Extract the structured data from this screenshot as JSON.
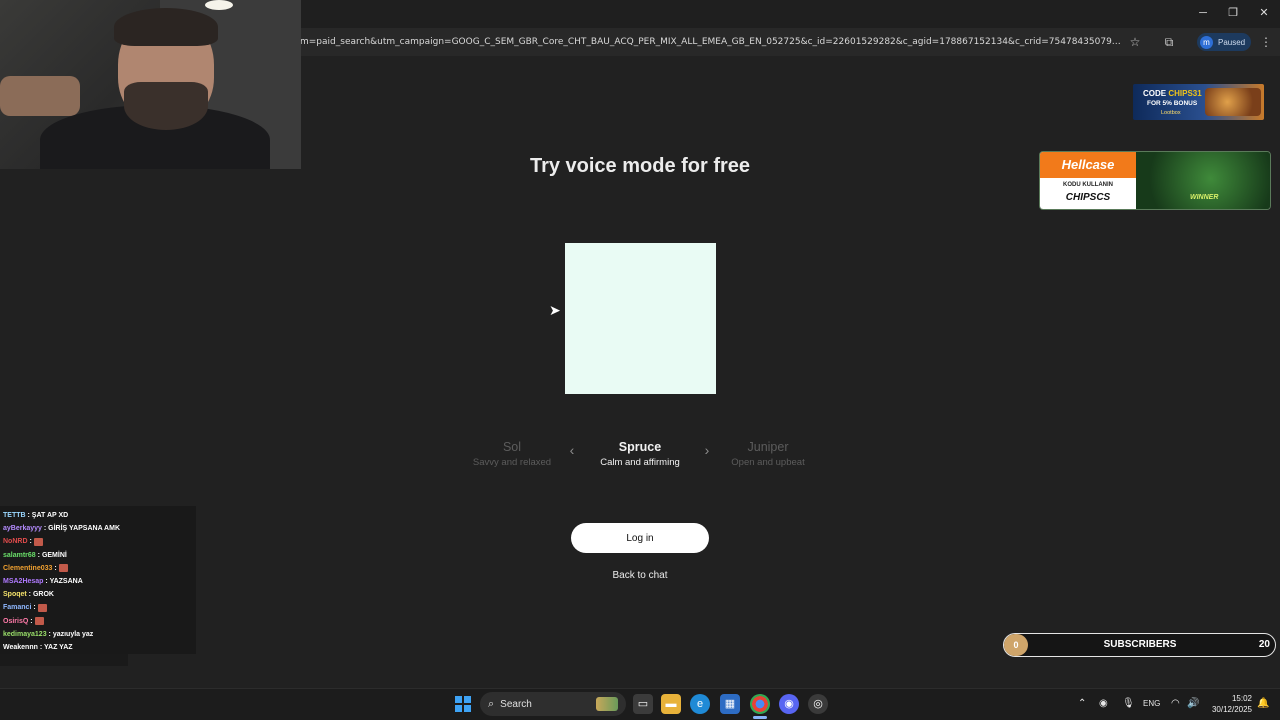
{
  "browser": {
    "url": "m=paid_search&utm_campaign=GOOG_C_SEM_GBR_Core_CHT_BAU_ACQ_PER_MIX_ALL_EMEA_GB_EN_052725&c_id=22601529282&c_agid=178867152134&c_crid=754784350792&c_kwid={keywor...",
    "profile_initial": "m",
    "profile_status": "Paused",
    "icons": [
      "star-icon",
      "extensions-icon",
      "menu-icon",
      "minimize-icon",
      "restore-icon",
      "close-icon"
    ]
  },
  "page": {
    "title": "Try voice mode for free",
    "orb_color": "#e9fbf4",
    "voices": {
      "prev": {
        "name": "Sol",
        "desc": "Savvy and relaxed"
      },
      "current": {
        "name": "Spruce",
        "desc": "Calm and affirming"
      },
      "next": {
        "name": "Juniper",
        "desc": "Open and upbeat"
      }
    },
    "login_label": "Log in",
    "back_label": "Back to chat"
  },
  "overlays": {
    "ad1": {
      "code_prefix": "CODE",
      "code": "CHIPS31",
      "bonus": "FOR 5% BONUS",
      "brand": "Lootbox"
    },
    "ad2": {
      "brand": "Hellcase",
      "line1": "KODU KULLANIN",
      "code": "CHIPSCS",
      "badge": "WINNER"
    },
    "subscribers": {
      "current": "0",
      "label": "SUBSCRIBERS",
      "goal": "20",
      "progress_fraction": 0
    }
  },
  "chat": [
    {
      "user": "TETTB",
      "color": "#9ad7ff",
      "msg": "ŞAT AP XD",
      "emote": false
    },
    {
      "user": "ayBerkayyy",
      "color": "#b48cff",
      "msg": "GİRİŞ YAPSANA AMK",
      "emote": false
    },
    {
      "user": "NoNRD",
      "color": "#e04b4b",
      "msg": "",
      "emote": true
    },
    {
      "user": "salamtr68",
      "color": "#6adf6a",
      "msg": "GEMİNİ",
      "emote": false
    },
    {
      "user": "Clementine033",
      "color": "#f0a030",
      "msg": "",
      "emote": true
    },
    {
      "user": "MSA2Hesap",
      "color": "#b07aff",
      "msg": "YAZSANA",
      "emote": false
    },
    {
      "user": "Spoqet",
      "color": "#f2e06a",
      "msg": "GROK",
      "emote": false
    },
    {
      "user": "Famanci",
      "color": "#8fb8ff",
      "msg": "",
      "emote": true
    },
    {
      "user": "OsirisQ",
      "color": "#ff7aa8",
      "msg": "",
      "emote": true
    },
    {
      "user": "kedimaya123",
      "color": "#9adf6a",
      "msg": "yazıuyla yaz",
      "emote": false
    },
    {
      "user": "Weakennn",
      "color": "#ffffff",
      "msg": "YAZ YAZ",
      "emote": false
    }
  ],
  "taskbar": {
    "search_label": "Search",
    "tray_lang": "ENG",
    "time": "15:02",
    "date": "30/12/2025",
    "apps": [
      "task-view-icon",
      "file-explorer-icon",
      "edge-icon",
      "store-icon",
      "chrome-icon",
      "discord-icon",
      "obs-icon"
    ]
  }
}
